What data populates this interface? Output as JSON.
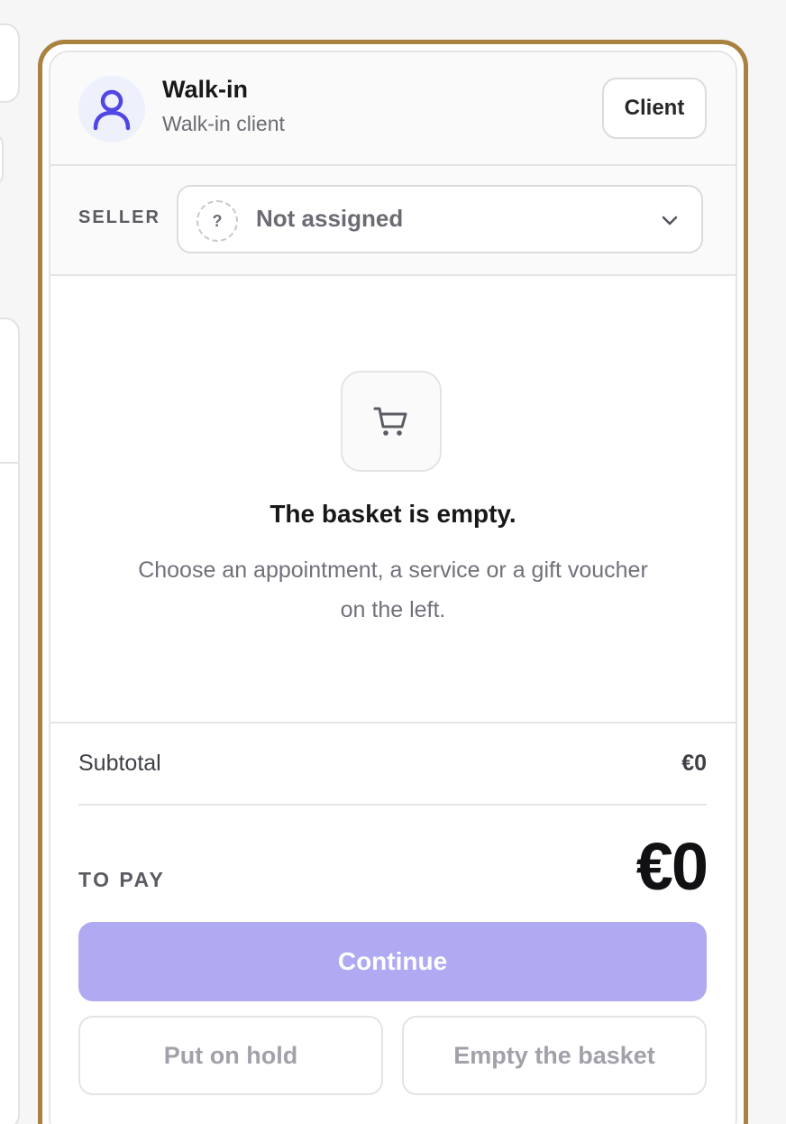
{
  "client": {
    "name": "Walk-in",
    "subtitle": "Walk-in client",
    "button_label": "Client"
  },
  "seller": {
    "label": "SELLER",
    "placeholder_symbol": "?",
    "selected_value": "Not assigned"
  },
  "basket": {
    "empty_title": "The basket is empty.",
    "empty_description": "Choose an appointment, a service or a gift voucher on the left."
  },
  "totals": {
    "subtotal_label": "Subtotal",
    "subtotal_value": "€0",
    "to_pay_label": "TO PAY",
    "to_pay_value": "€0"
  },
  "actions": {
    "continue_label": "Continue",
    "hold_label": "Put on hold",
    "empty_label": "Empty the basket"
  },
  "colors": {
    "accent_ring": "#a98240",
    "continue_bg": "#afaaf2",
    "avatar_icon": "#4f46e5"
  },
  "icons": {
    "avatar": "user-icon",
    "seller_dropdown": "chevron-down-icon",
    "empty_basket": "shopping-cart-icon"
  }
}
